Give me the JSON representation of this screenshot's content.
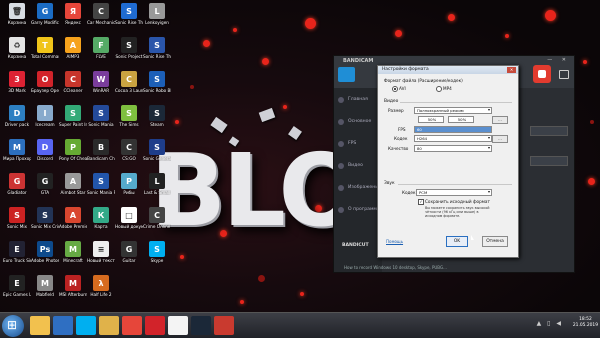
{
  "wallpaper": {
    "logo_text": "BLOI",
    "accent_color": "#e8241b"
  },
  "desktop_icons": [
    {
      "label": "Корзина",
      "color": "#d9dde3",
      "glyph": "🗑"
    },
    {
      "label": "Garry Modifications",
      "color": "#1b6cc4",
      "glyph": "G"
    },
    {
      "label": "Яндекс",
      "color": "#e6463a",
      "glyph": "Я"
    },
    {
      "label": "Car Mechanic Simulator",
      "color": "#444",
      "glyph": "C"
    },
    {
      "label": "Sonic Rise The Shell",
      "color": "#1f6bd1",
      "glyph": "S"
    },
    {
      "label": "Lenkoyigen",
      "color": "#999",
      "glyph": "L"
    },
    {
      "label": "Корзина",
      "color": "#e4e4e4",
      "glyph": "♻"
    },
    {
      "label": "Total Commander",
      "color": "#f0c419",
      "glyph": "T"
    },
    {
      "label": "AIMP3",
      "color": "#f6a21c",
      "glyph": "A"
    },
    {
      "label": "FLVE",
      "color": "#5a6",
      "glyph": "F"
    },
    {
      "label": "Sonic Project",
      "color": "#222",
      "glyph": "S"
    },
    {
      "label": "Sonic Rise The Shell",
      "color": "#2a55aa",
      "glyph": "S"
    },
    {
      "label": "3D Mark",
      "color": "#d23",
      "glyph": "3"
    },
    {
      "label": "Браузер Opera",
      "color": "#d2232a",
      "glyph": "O"
    },
    {
      "label": "CCleaner",
      "color": "#c7352b",
      "glyph": "C"
    },
    {
      "label": "WinRAR",
      "color": "#7a3d9c",
      "glyph": "W"
    },
    {
      "label": "Cocoa 3 Launcher",
      "color": "#caa341",
      "glyph": "C"
    },
    {
      "label": "Sonic Robo Blast",
      "color": "#1c5fb8",
      "glyph": "S"
    },
    {
      "label": "Driver pack",
      "color": "#2d7fc2",
      "glyph": "D"
    },
    {
      "label": "Icecream",
      "color": "#8ac",
      "glyph": "I"
    },
    {
      "label": "Super Paint Infinite",
      "color": "#3a7",
      "glyph": "S"
    },
    {
      "label": "Sonic Mania",
      "color": "#244a9a",
      "glyph": "S"
    },
    {
      "label": "The Sims",
      "color": "#7fbf3f",
      "glyph": "S"
    },
    {
      "label": "Steam",
      "color": "#1b2838",
      "glyph": "S"
    },
    {
      "label": "Мира Прохор",
      "color": "#2c6fbe",
      "glyph": "M"
    },
    {
      "label": "Discord",
      "color": "#5865f2",
      "glyph": "D"
    },
    {
      "label": "Pony Of Cheat",
      "color": "#6a3",
      "glyph": "P"
    },
    {
      "label": "Bandicam Cheatmans",
      "color": "#2a2a2a",
      "glyph": "B"
    },
    {
      "label": "CS:GO",
      "color": "#333",
      "glyph": "C"
    },
    {
      "label": "Sonic Generations",
      "color": "#1e3d8a",
      "glyph": "S"
    },
    {
      "label": "Gladiator",
      "color": "#c33",
      "glyph": "G"
    },
    {
      "label": "GTA",
      "color": "#222",
      "glyph": "G"
    },
    {
      "label": "Aimbot Star",
      "color": "#999",
      "glyph": "A"
    },
    {
      "label": "Sonic Mania Plus",
      "color": "#2255aa",
      "glyph": "S"
    },
    {
      "label": "Рибы",
      "color": "#5ac",
      "glyph": "Р"
    },
    {
      "label": "Last & Small",
      "color": "#222",
      "glyph": "L"
    },
    {
      "label": "Sonic Mix",
      "color": "#c22",
      "glyph": "S"
    },
    {
      "label": "Sonic Mix Criminal",
      "color": "#235",
      "glyph": "S"
    },
    {
      "label": "Adobe Premiere",
      "color": "#d9462f",
      "glyph": "A"
    },
    {
      "label": "Карта",
      "color": "#3a8",
      "glyph": "К"
    },
    {
      "label": "Новый документ",
      "color": "#fff",
      "glyph": "□"
    },
    {
      "label": "Crime Online the Ultimate",
      "color": "#444",
      "glyph": "C"
    },
    {
      "label": "Euro Truck Simulator",
      "color": "#223",
      "glyph": "E"
    },
    {
      "label": "Adobe Photoshop",
      "color": "#0d4a8c",
      "glyph": "Ps"
    },
    {
      "label": "Minecraft",
      "color": "#6a4",
      "glyph": "M"
    },
    {
      "label": "Новый текстовый",
      "color": "#eee",
      "glyph": "≡"
    },
    {
      "label": "Guitar",
      "color": "#333",
      "glyph": "G"
    },
    {
      "label": "Skype",
      "color": "#00aff0",
      "glyph": "S"
    },
    {
      "label": "Epic Games Launcher",
      "color": "#222",
      "glyph": "E"
    },
    {
      "label": "Mabfield",
      "color": "#888",
      "glyph": "M"
    },
    {
      "label": "MSI Afterburner",
      "color": "#b22",
      "glyph": "M"
    },
    {
      "label": "Half Life 2",
      "color": "#d66b1f",
      "glyph": "λ"
    }
  ],
  "bandicam": {
    "brand": "BANDICAM",
    "window_controls": "—  ✕",
    "sidebar": [
      "Главная",
      "Основное",
      "FPS",
      "Видео",
      "Изображение",
      "О программе"
    ],
    "footer_brand": "BANDICUT",
    "bottom_text": "How to record Windows 10 desktop, Skype, PUBG..."
  },
  "dialog": {
    "title": "Настройки формата",
    "file_format_label": "Формат файла (Расширение/кодек)",
    "format_avi": "AVI",
    "format_mp4": "MP4",
    "video_section": "Видео",
    "size_label": "Размер",
    "size_value": "Полноэкранный режим",
    "size_w": "50%",
    "size_h": "50%",
    "fps_label": "FPS",
    "fps_value": "60",
    "codec_label": "Кодек",
    "codec_value": "H264",
    "quality_label": "Качество",
    "quality_value": "80",
    "audio_section": "Звук",
    "audio_codec_label": "Кодек",
    "audio_codec_value": "PCM",
    "keep_original_label": "Сохранить исходный формат",
    "keep_original_note": "Вы можете сохранить звук высокой чёткости (96 кГц или выше) в исходном формате.",
    "help_link": "Помощь",
    "ok_label": "OK",
    "cancel_label": "Отмена",
    "side_btn_1": "...",
    "side_btn_2": "..."
  },
  "taskbar": {
    "apps": [
      {
        "name": "explorer",
        "color": "#f2c14e"
      },
      {
        "name": "media",
        "color": "#2f6fc2"
      },
      {
        "name": "skype",
        "color": "#00aff0"
      },
      {
        "name": "folder",
        "color": "#e0b24a"
      },
      {
        "name": "yandex",
        "color": "#e6463a"
      },
      {
        "name": "opera",
        "color": "#d2232a"
      },
      {
        "name": "yandex-browser",
        "color": "#f4f4f4"
      },
      {
        "name": "steam",
        "color": "#1b2838"
      },
      {
        "name": "bandicam",
        "color": "#c93a2f"
      }
    ],
    "time": "18:52",
    "date": "21.05.2019"
  }
}
